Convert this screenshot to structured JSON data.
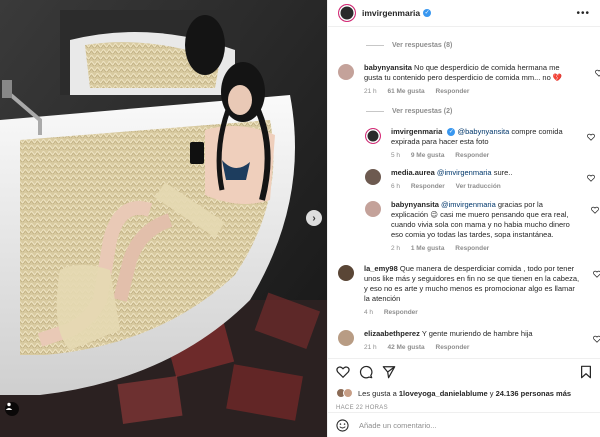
{
  "header": {
    "username": "imvirgenmaria",
    "verified": true,
    "more_icon": "more-horizontal-icon"
  },
  "comments": [
    {
      "type": "view_replies",
      "label": "Ver respuestas (8)"
    },
    {
      "type": "comment",
      "username": "babynyansita",
      "text": "No que desperdicio de comida hermana me gusta tu contenido pero desperdicio de comida mm... no",
      "emoji": "💔",
      "time": "21 h",
      "likes": "61 Me gusta",
      "reply": "Responder"
    },
    {
      "type": "view_replies",
      "label": "Ver respuestas (2)"
    },
    {
      "type": "reply",
      "username": "imvirgenmaria",
      "mention": "@babynyansita",
      "text": "compre comida expirada para hacer esta foto",
      "time": "5 h",
      "likes": "9 Me gusta",
      "reply": "Responder"
    },
    {
      "type": "reply",
      "username": "media.aurea",
      "mention": "@imvirgenmaria",
      "text": "sure..",
      "time": "6 h",
      "reply": "Responder",
      "translate": "Ver traducción"
    },
    {
      "type": "reply",
      "username": "babynyansita",
      "mention": "@imvirgenmaria",
      "text": "gracias por la explicación 😉 casi me muero pensando que era real, cuando vivia sola con mama y no habia mucho dinero eso comia yo todas las tardes, sopa instantánea.",
      "time": "2 h",
      "likes": "1 Me gusta",
      "reply": "Responder"
    },
    {
      "type": "comment",
      "username": "la_emy98",
      "text": "Que manera de desperdiciar comida , todo por tener unos like más y seguidores en fin no se que tienen en la cabeza, y eso no es arte y mucho menos es promocionar algo es llamar la atención",
      "time": "4 h",
      "reply": "Responder"
    },
    {
      "type": "comment",
      "username": "elizaabethperez",
      "text": "Y gente muriendo de hambre hija",
      "time": "21 h",
      "likes": "42 Me gusta",
      "reply": "Responder"
    }
  ],
  "actions": {
    "icons": [
      "heart-icon",
      "comment-icon",
      "share-icon",
      "bookmark-icon"
    ],
    "likes_prefix": "Les gusta a ",
    "likes_user": "1loveyoga_danielablume",
    "likes_middle": " y ",
    "likes_count": "24.136 personas más",
    "time_ago": "HACE 22 HORAS"
  },
  "add_comment": {
    "placeholder": "Añade un comentario...",
    "emoji_icon": "smiley-icon"
  }
}
